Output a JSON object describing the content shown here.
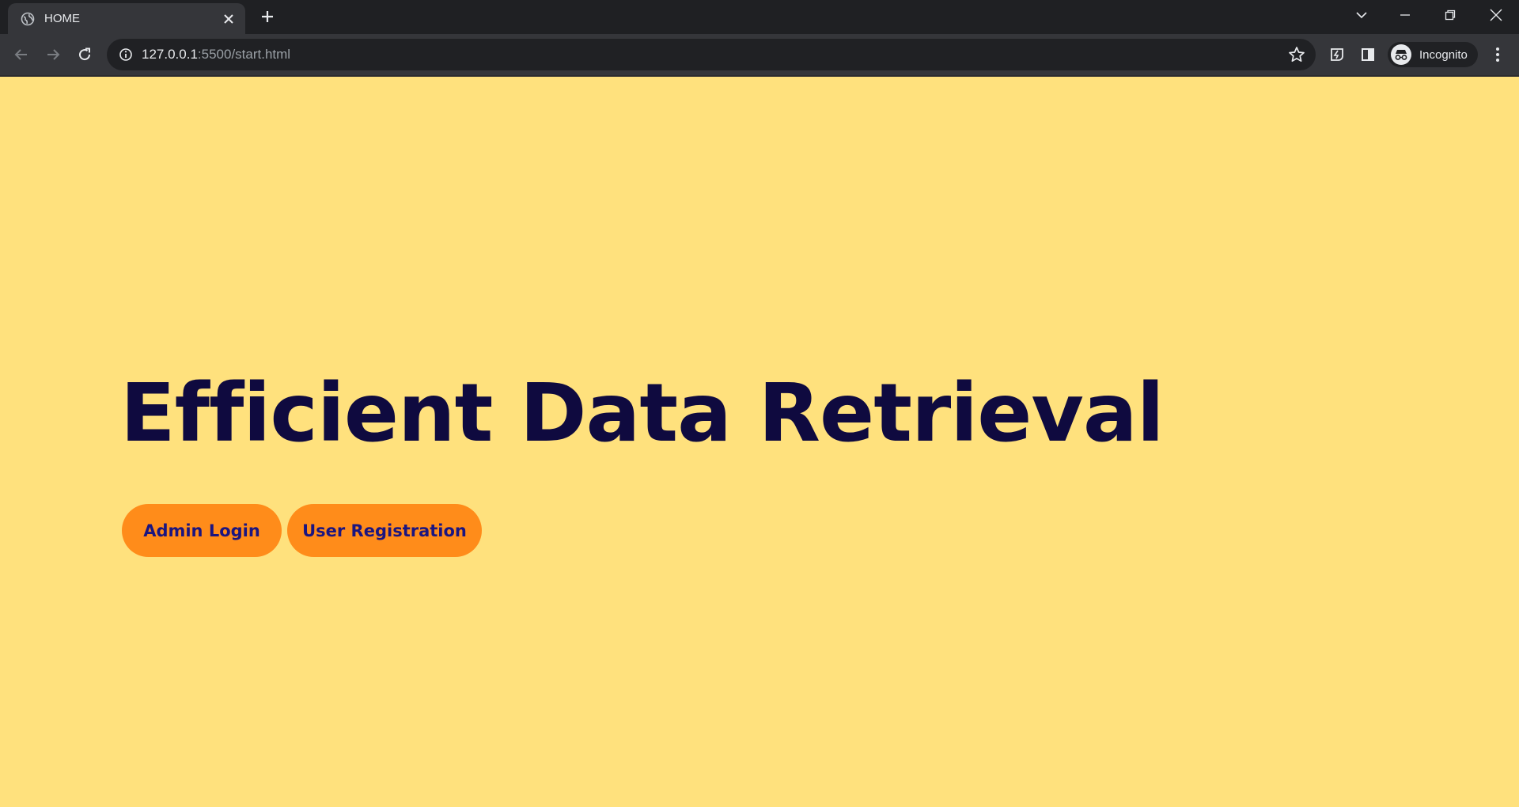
{
  "browser": {
    "tab": {
      "title": "HOME",
      "favicon": "globe-icon"
    },
    "address": {
      "host": "127.0.0.1",
      "rest": ":5500/start.html"
    },
    "profile": {
      "label": "Incognito"
    }
  },
  "page": {
    "title": "Efficient Data Retrieval",
    "buttons": {
      "admin_login": "Admin Login",
      "user_registration": "User Registration"
    }
  },
  "colors": {
    "page_background": "#ffe17d",
    "title_text": "#0f0a3f",
    "button_background": "#ff8c1a",
    "button_text": "#1b1580"
  }
}
